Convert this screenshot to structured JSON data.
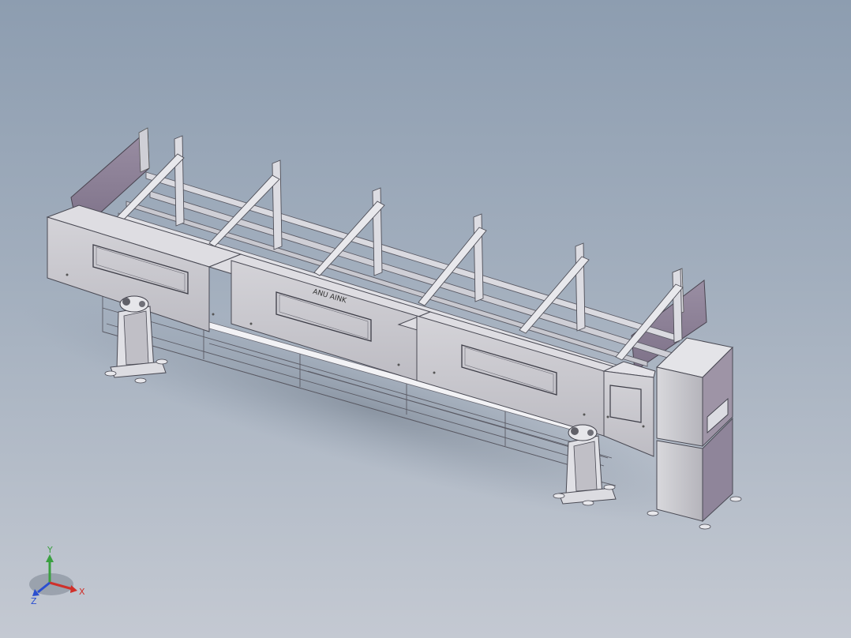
{
  "viewport": {
    "background_top": "#8d9db0",
    "background_bottom": "#c4c9d2"
  },
  "model": {
    "panel_text": "ANU AINK",
    "frame_color": "#d6d6dc",
    "panel_color": "#c9c8cd",
    "panel_dark": "#8a7f92",
    "cabinet_color": "#cfcfd3"
  },
  "triad": {
    "x_label": "X",
    "y_label": "Y",
    "z_label": "Z",
    "x_color": "#d0302a",
    "y_color": "#3aa040",
    "z_color": "#2a4fd0"
  }
}
